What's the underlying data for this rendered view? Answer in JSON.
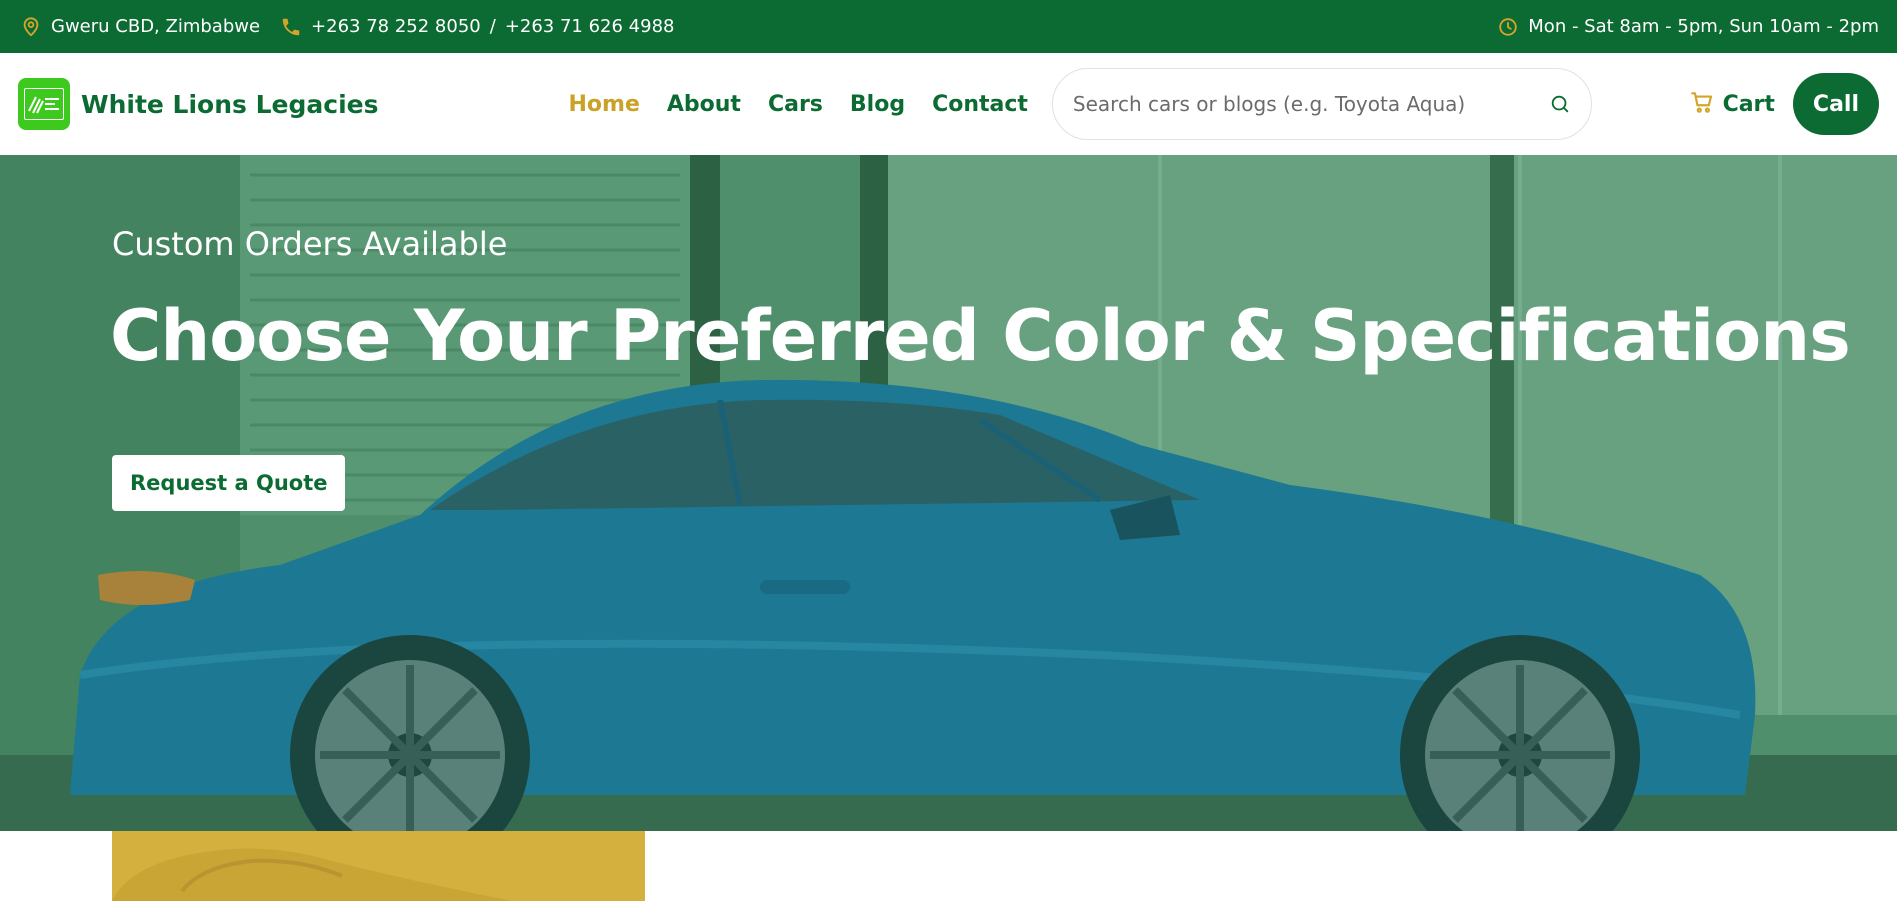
{
  "topbar": {
    "location": "Gweru CBD, Zimbabwe",
    "phone_1": "+263 78 252 8050",
    "phone_separator": "/",
    "phone_2": "+263 71 626 4988",
    "hours": "Mon - Sat 8am - 5pm, Sun 10am - 2pm",
    "icons": [
      "map-pin-icon",
      "phone-icon",
      "clock-icon"
    ],
    "icon_color": "#d4a52b"
  },
  "header": {
    "brand_name": "White Lions Legacies",
    "nav": [
      {
        "label": "Home",
        "active": true
      },
      {
        "label": "About",
        "active": false
      },
      {
        "label": "Cars",
        "active": false
      },
      {
        "label": "Blog",
        "active": false
      },
      {
        "label": "Contact",
        "active": false
      }
    ],
    "search_placeholder": "Search cars or blogs (e.g. Toyota Aqua)",
    "cart_label": "Cart",
    "call_label": "Call"
  },
  "hero": {
    "subtitle": "Custom Orders Available",
    "title": "Choose Your Preferred Color & Specifications",
    "cta_label": "Request a Quote"
  },
  "colors": {
    "brand_green": "#0c6b33",
    "accent_gold": "#c9a227",
    "logo_green": "#3ec91e",
    "card_gold": "#d4b13f"
  }
}
